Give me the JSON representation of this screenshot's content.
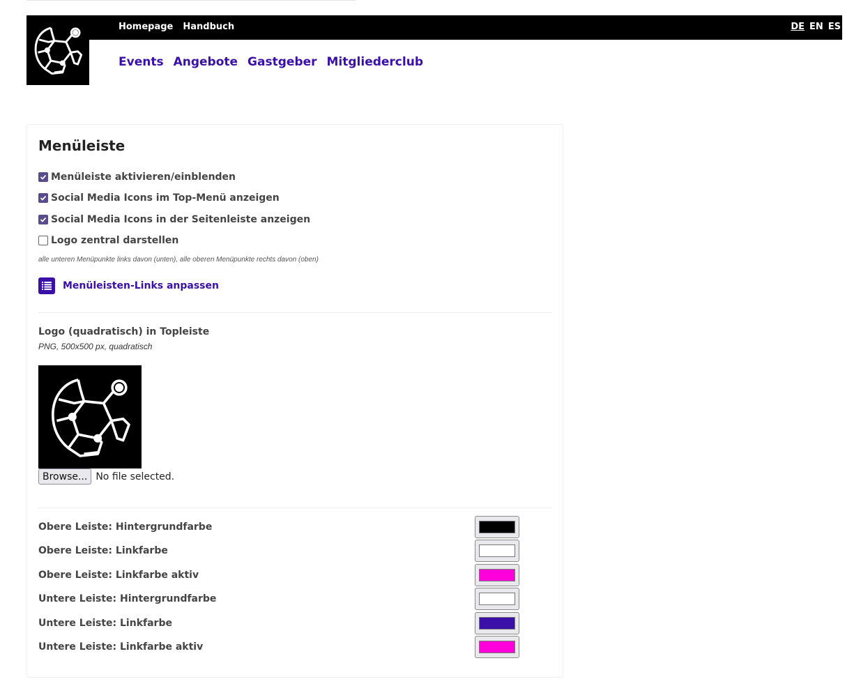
{
  "header": {
    "top_links": [
      "Homepage",
      "Handbuch"
    ],
    "languages": [
      {
        "code": "DE",
        "active": true
      },
      {
        "code": "EN",
        "active": false
      },
      {
        "code": "ES",
        "active": false
      }
    ],
    "main_links": [
      "Events",
      "Angebote",
      "Gastgeber",
      "Mitgliederclub"
    ],
    "logo_icon": "soccer-ball-icon"
  },
  "panel": {
    "title": "Menüleiste",
    "checkboxes": [
      {
        "label": "Menüleiste aktivieren/einblenden",
        "checked": true
      },
      {
        "label": "Social Media Icons im Top-Menü anzeigen",
        "checked": true
      },
      {
        "label": "Social Media Icons in der Seitenleiste anzeigen",
        "checked": true
      },
      {
        "label": "Logo zentral darstellen",
        "checked": false
      }
    ],
    "note": "alle unteren Menüpunkte links davon (unten), alle oberen Menüpunkte rechts davon (oben)",
    "adjust_links_label": "Menüleisten-Links anpassen",
    "logo_section": {
      "title": "Logo (quadratisch) in Topleiste",
      "subtitle": "PNG, 500x500 px, quadratisch",
      "browse_label": "Browse...",
      "file_status": "No file selected."
    },
    "colors": [
      {
        "label": "Obere Leiste: Hintergrundfarbe",
        "value": "#000000"
      },
      {
        "label": "Obere Leiste: Linkfarbe",
        "value": "#ffffff"
      },
      {
        "label": "Obere Leiste: Linkfarbe aktiv",
        "value": "#ff00dd"
      },
      {
        "label": "Untere Leiste: Hintergrundfarbe",
        "value": "#ffffff"
      },
      {
        "label": "Untere Leiste: Linkfarbe",
        "value": "#3a10a8"
      },
      {
        "label": "Untere Leiste: Linkfarbe aktiv",
        "value": "#ff00dd"
      }
    ]
  },
  "colors": {
    "accent": "#3a10a8",
    "topbar": "#000000",
    "checkbox": "#5a4b8a"
  }
}
